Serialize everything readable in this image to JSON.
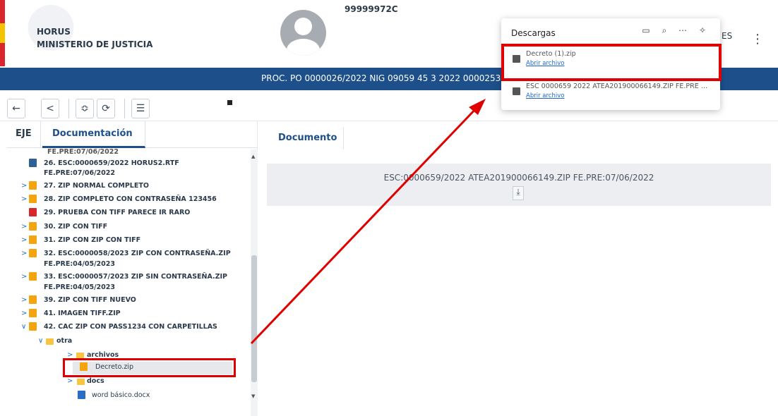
{
  "header": {
    "brand_line1": "HORUS",
    "brand_line2": "MINISTERIO DE JUSTICIA",
    "user_id": "99999972C",
    "language": "ES",
    "menu_icon": "kebab-menu-icon"
  },
  "proc_bar": {
    "text": "PROC. PO 0000026/2022 NIG 09059 45 3 2022 0000253"
  },
  "toolbar": {
    "buttons": [
      "←",
      "<",
      "≎",
      "⟳",
      "☰"
    ]
  },
  "left_tabs": {
    "eje": "EJE",
    "documentacion": "Documentación"
  },
  "tree": {
    "rows": [
      {
        "label": "FE.PRE:07/06/2022"
      },
      {
        "label": "26. ESC:0000659/2022 HORUS2.RTF"
      },
      {
        "label": "FE.PRE:07/06/2022"
      },
      {
        "label": "27. ZIP NORMAL COMPLETO"
      },
      {
        "label": "28. ZIP COMPLETO CON CONTRASEÑA 123456"
      },
      {
        "label": "29. PRUEBA CON TIFF PARECE IR RARO"
      },
      {
        "label": "30. ZIP CON TIFF"
      },
      {
        "label": "31. ZIP CON ZIP CON TIFF"
      },
      {
        "label": "32. ESC:0000058/2023 ZIP CON CONTRASEÑA.ZIP"
      },
      {
        "label": "FE.PRE:04/05/2023"
      },
      {
        "label": "33. ESC:0000057/2023 ZIP SIN CONTRASEÑA.ZIP"
      },
      {
        "label": "FE.PRE:04/05/2023"
      },
      {
        "label": "39. ZIP CON TIFF NUEVO"
      },
      {
        "label": "41. IMAGEN TIFF.ZIP"
      },
      {
        "label": "42. CAC ZIP CON PASS1234 CON CARPETILLAS"
      },
      {
        "label": "otra"
      },
      {
        "label": "archivos"
      },
      {
        "label": "Decreto.zip"
      },
      {
        "label": "docs"
      },
      {
        "label": "word básico.docx"
      }
    ]
  },
  "document": {
    "tab": "Documento",
    "filename": "ESC:0000659/2022 ATEA201900066149.ZIP FE.PRE:07/06/2022",
    "download_glyph": "⤓"
  },
  "downloads": {
    "title": "Descargas",
    "items": [
      {
        "name": "Decreto (1).zip",
        "action": "Abrir archivo"
      },
      {
        "name": "ESC 0000659 2022 ATEA201900066149.ZIP FE.PRE 07 06 ...",
        "action": "Abrir archivo"
      }
    ]
  },
  "colors": {
    "brand_blue": "#1d4f8a",
    "highlight_red": "#e00000",
    "zip_orange": "#f3a40f"
  }
}
